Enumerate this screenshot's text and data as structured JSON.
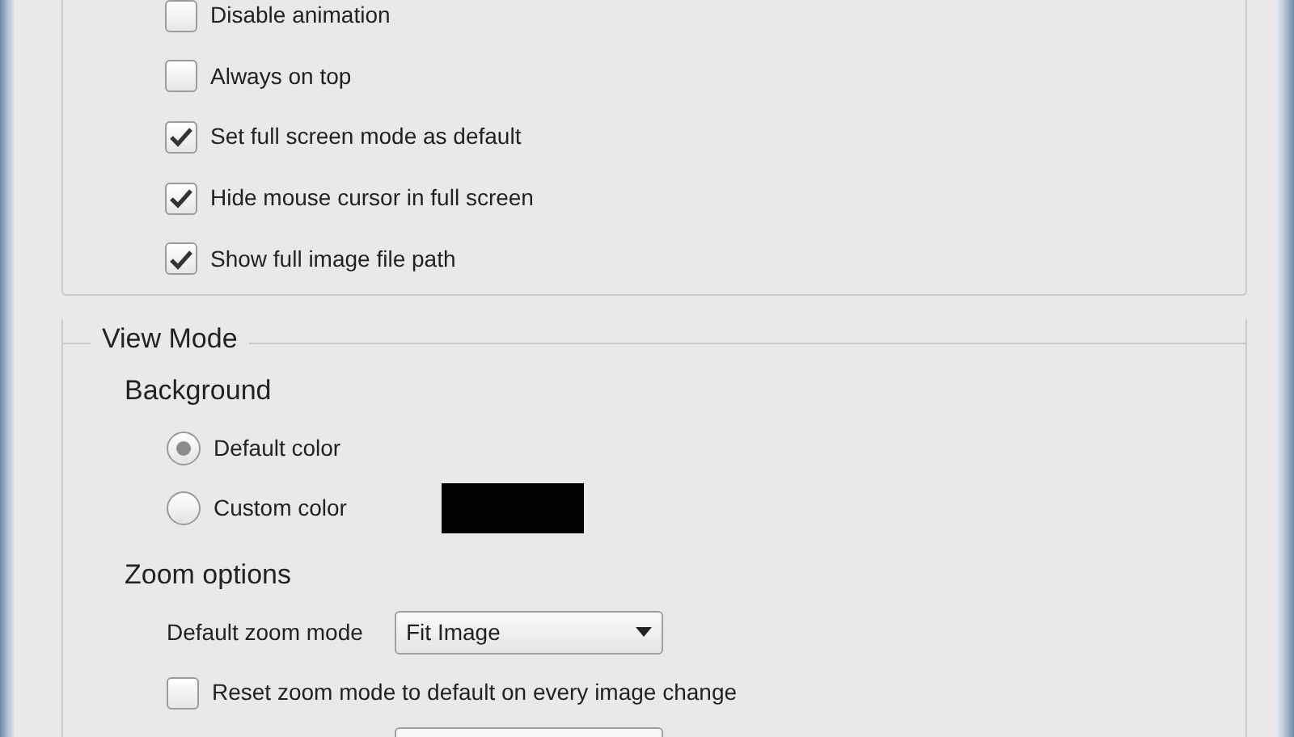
{
  "general_options": {
    "checkboxes": [
      {
        "label": "Disable animation",
        "checked": false
      },
      {
        "label": "Always on top",
        "checked": false
      },
      {
        "label": "Set full screen mode as default",
        "checked": true
      },
      {
        "label": "Hide mouse cursor in full screen",
        "checked": true
      },
      {
        "label": "Show full image file path",
        "checked": true
      }
    ]
  },
  "view_mode": {
    "title": "View Mode",
    "background": {
      "title": "Background",
      "options": [
        {
          "label": "Default color",
          "selected": true
        },
        {
          "label": "Custom color",
          "selected": false,
          "color": "#000000"
        }
      ]
    },
    "zoom": {
      "title": "Zoom options",
      "default_zoom_mode": {
        "label": "Default zoom mode",
        "value": "Fit Image"
      },
      "reset_on_change": {
        "label": "Reset zoom mode to default on every image change",
        "checked": false
      }
    }
  }
}
